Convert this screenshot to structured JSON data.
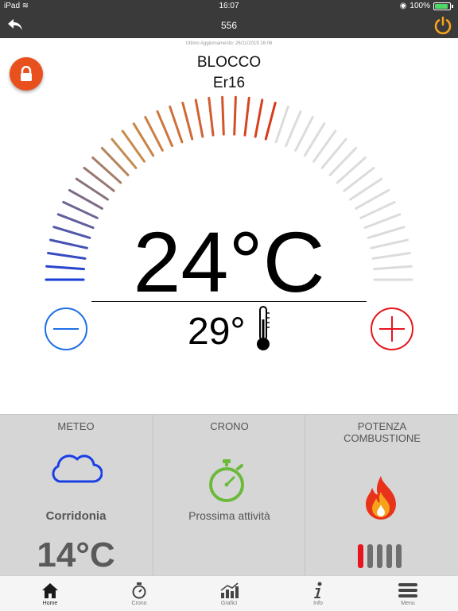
{
  "status_bar": {
    "device": "iPad",
    "time": "16:07",
    "battery": "100%"
  },
  "nav": {
    "title": "556"
  },
  "last_update": "Ultimo Aggiornamento: 26/11/2019 16:06",
  "state": {
    "title": "BLOCCO",
    "code": "Er16"
  },
  "temperature": {
    "set": "24°C",
    "room": "29°"
  },
  "gauge": {
    "ticks": 44,
    "active_ticks": 26,
    "color_cold": "#1a3fd6",
    "color_mid": "#c98e4a",
    "color_hot": "#d83a1a",
    "color_inactive": "#dcdcdc"
  },
  "colors": {
    "bar": "#3a3a3a",
    "accent": "#e8501e",
    "power": "#f5a31a",
    "minus": "#1f6fe6",
    "plus": "#e8141e",
    "panel": "#d6d6d6",
    "weather_icon": "#1a3fe6",
    "crono_icon": "#6cba3c"
  },
  "panel": {
    "meteo": {
      "title": "METEO",
      "city": "Corridonia",
      "temp": "14°C",
      "icon": "cloud-icon"
    },
    "crono": {
      "title": "CRONO",
      "next": "Prossima attività",
      "icon": "stopwatch-icon"
    },
    "potenza": {
      "title_line1": "POTENZA",
      "title_line2": "COMBUSTIONE",
      "level": 1,
      "max_level": 5,
      "icon": "flame-icon"
    }
  },
  "tabs": [
    {
      "label": "Home",
      "icon": "home-icon"
    },
    {
      "label": "Crono",
      "icon": "stopwatch-icon"
    },
    {
      "label": "Grafici",
      "icon": "chart-icon"
    },
    {
      "label": "Info",
      "icon": "info-icon"
    },
    {
      "label": "Menu",
      "icon": "menu-icon"
    }
  ]
}
